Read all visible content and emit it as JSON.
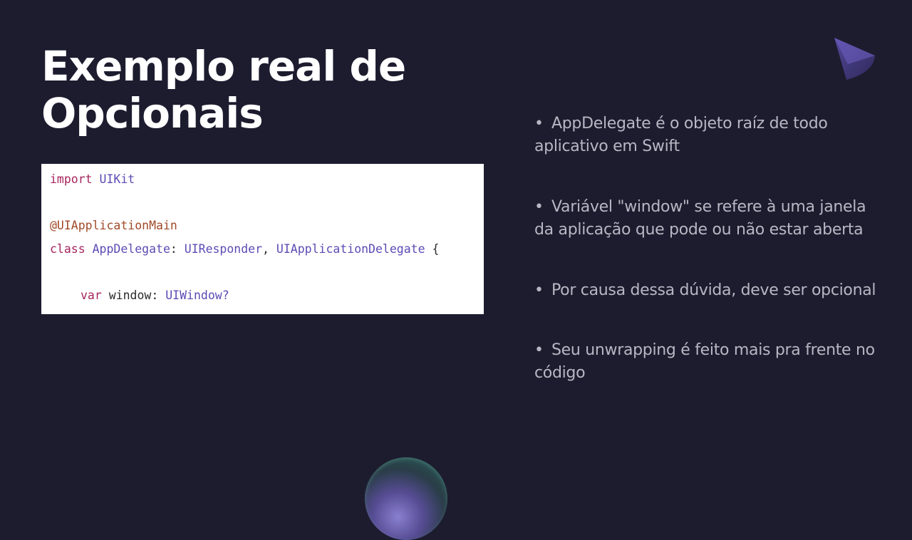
{
  "slide": {
    "title_lines": [
      "Exemplo real de",
      "Opcionais"
    ],
    "code": {
      "import_kw": "import",
      "import_mod": "UIKit",
      "attribute": "@UIApplicationMain",
      "class_kw": "class",
      "class_name": "AppDelegate",
      "colon1": ":",
      "super_type": "UIResponder",
      "comma": ",",
      "protocol": "UIApplicationDelegate",
      "brace": "{",
      "var_kw": "var",
      "var_name": "window",
      "colon2": ":",
      "var_type": "UIWindow?"
    },
    "bullet_marker": "•",
    "bullets": [
      "AppDelegate é o objeto raíz de todo aplicativo em Swift",
      "Variável \"window\" se refere à uma janela da aplicação que pode ou não estar aberta",
      "Por causa dessa dúvida, deve ser opcional",
      "Seu unwrapping é feito mais pra frente no código"
    ],
    "decorations": [
      "triangle-shape",
      "sphere-shape"
    ],
    "colors": {
      "background": "#1d1c2f",
      "title": "#ffffff",
      "bullet_text": "#b8b7c4",
      "code_keyword": "#a6255d",
      "code_type": "#5c4bb5",
      "code_attribute": "#a04a28"
    }
  }
}
